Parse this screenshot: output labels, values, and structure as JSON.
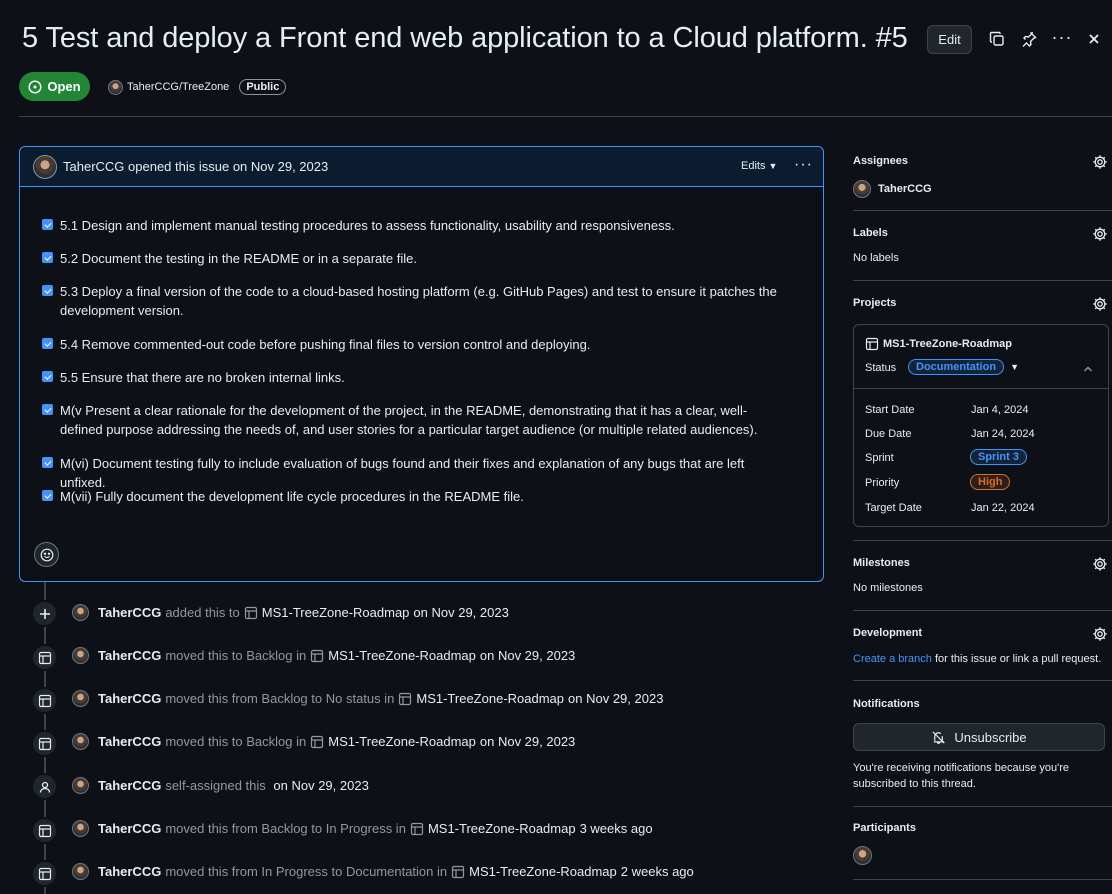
{
  "issue": {
    "title": "5 Test and deploy a Front end web application to a Cloud platform. #5",
    "edit_label": "Edit",
    "state": "Open",
    "repo": "TaherCCG/TreeZone",
    "visibility": "Public",
    "opened_by": "TaherCCG opened this issue on Nov 29, 2023",
    "edits_label": "Edits",
    "tasks": [
      "5.1 Design and implement manual testing procedures to assess functionality, usability and responsiveness.",
      "5.2 Document the testing in the README or in a separate file.",
      "5.3 Deploy a final version of the code to a cloud-based hosting platform (e.g. GitHub Pages) and test to ensure it patches the development version.",
      "5.4 Remove commented-out code before pushing final files to version control and deploying.",
      "5.5 Ensure that there are no broken internal links.",
      "M(v Present a clear rationale for the development of the project, in the README, demonstrating that it has a clear, well-defined purpose addressing the needs of, and user stories for a particular target audience (or multiple related audiences).",
      "M(vi) Document testing fully to include evaluation of bugs found and their fixes and explanation of any bugs that are left unfixed.",
      "M(vii) Fully document the development life cycle procedures in the README file."
    ]
  },
  "timeline": [
    {
      "icon": "plus-icon",
      "user": "TaherCCG",
      "pre": "added this to",
      "project": "MS1-TreeZone-Roadmap",
      "post": "on Nov 29, 2023"
    },
    {
      "icon": "table-icon",
      "user": "TaherCCG",
      "pre": "moved this to Backlog in",
      "project": "MS1-TreeZone-Roadmap",
      "post": "on Nov 29, 2023"
    },
    {
      "icon": "table-icon",
      "user": "TaherCCG",
      "pre": "moved this from Backlog to No status in",
      "project": "MS1-TreeZone-Roadmap",
      "post": "on Nov 29, 2023"
    },
    {
      "icon": "table-icon",
      "user": "TaherCCG",
      "pre": "moved this to Backlog in",
      "project": "MS1-TreeZone-Roadmap",
      "post": "on Nov 29, 2023"
    },
    {
      "icon": "person-icon",
      "user": "TaherCCG",
      "pre": "self-assigned this",
      "project": "",
      "post": " on Nov 29, 2023"
    },
    {
      "icon": "table-icon",
      "user": "TaherCCG",
      "pre": "moved this from Backlog to In Progress in",
      "project": "MS1-TreeZone-Roadmap",
      "post": "3 weeks ago"
    },
    {
      "icon": "table-icon",
      "user": "TaherCCG",
      "pre": "moved this from In Progress to Documentation in",
      "project": "MS1-TreeZone-Roadmap",
      "post": "2 weeks ago"
    }
  ],
  "sidebar": {
    "assignees": {
      "heading": "Assignees",
      "user": "TaherCCG"
    },
    "labels": {
      "heading": "Labels",
      "value": "No labels"
    },
    "projects": {
      "heading": "Projects",
      "name": "MS1-TreeZone-Roadmap",
      "status_label": "Status",
      "status_value": "Documentation",
      "fields": [
        {
          "label": "Start Date",
          "value": "Jan 4, 2024",
          "pill": false
        },
        {
          "label": "Due Date",
          "value": "Jan 24, 2024",
          "pill": false
        },
        {
          "label": "Sprint",
          "value": "Sprint 3",
          "pill": true,
          "color": "#4493f8"
        },
        {
          "label": "Priority",
          "value": "High",
          "pill": true,
          "color": "#db6d28"
        },
        {
          "label": "Target Date",
          "value": "Jan 22, 2024",
          "pill": false
        }
      ]
    },
    "milestones": {
      "heading": "Milestones",
      "value": "No milestones"
    },
    "development": {
      "heading": "Development",
      "link": "Create a branch",
      "rest": " for this issue or link a pull request."
    },
    "notifications": {
      "heading": "Notifications",
      "button": "Unsubscribe",
      "text": "You're receiving notifications because you're subscribed to this thread."
    },
    "participants": {
      "heading": "Participants"
    }
  },
  "colors": {
    "accent": "#4493f8",
    "open": "#238636",
    "priority_high": "#db6d28"
  }
}
